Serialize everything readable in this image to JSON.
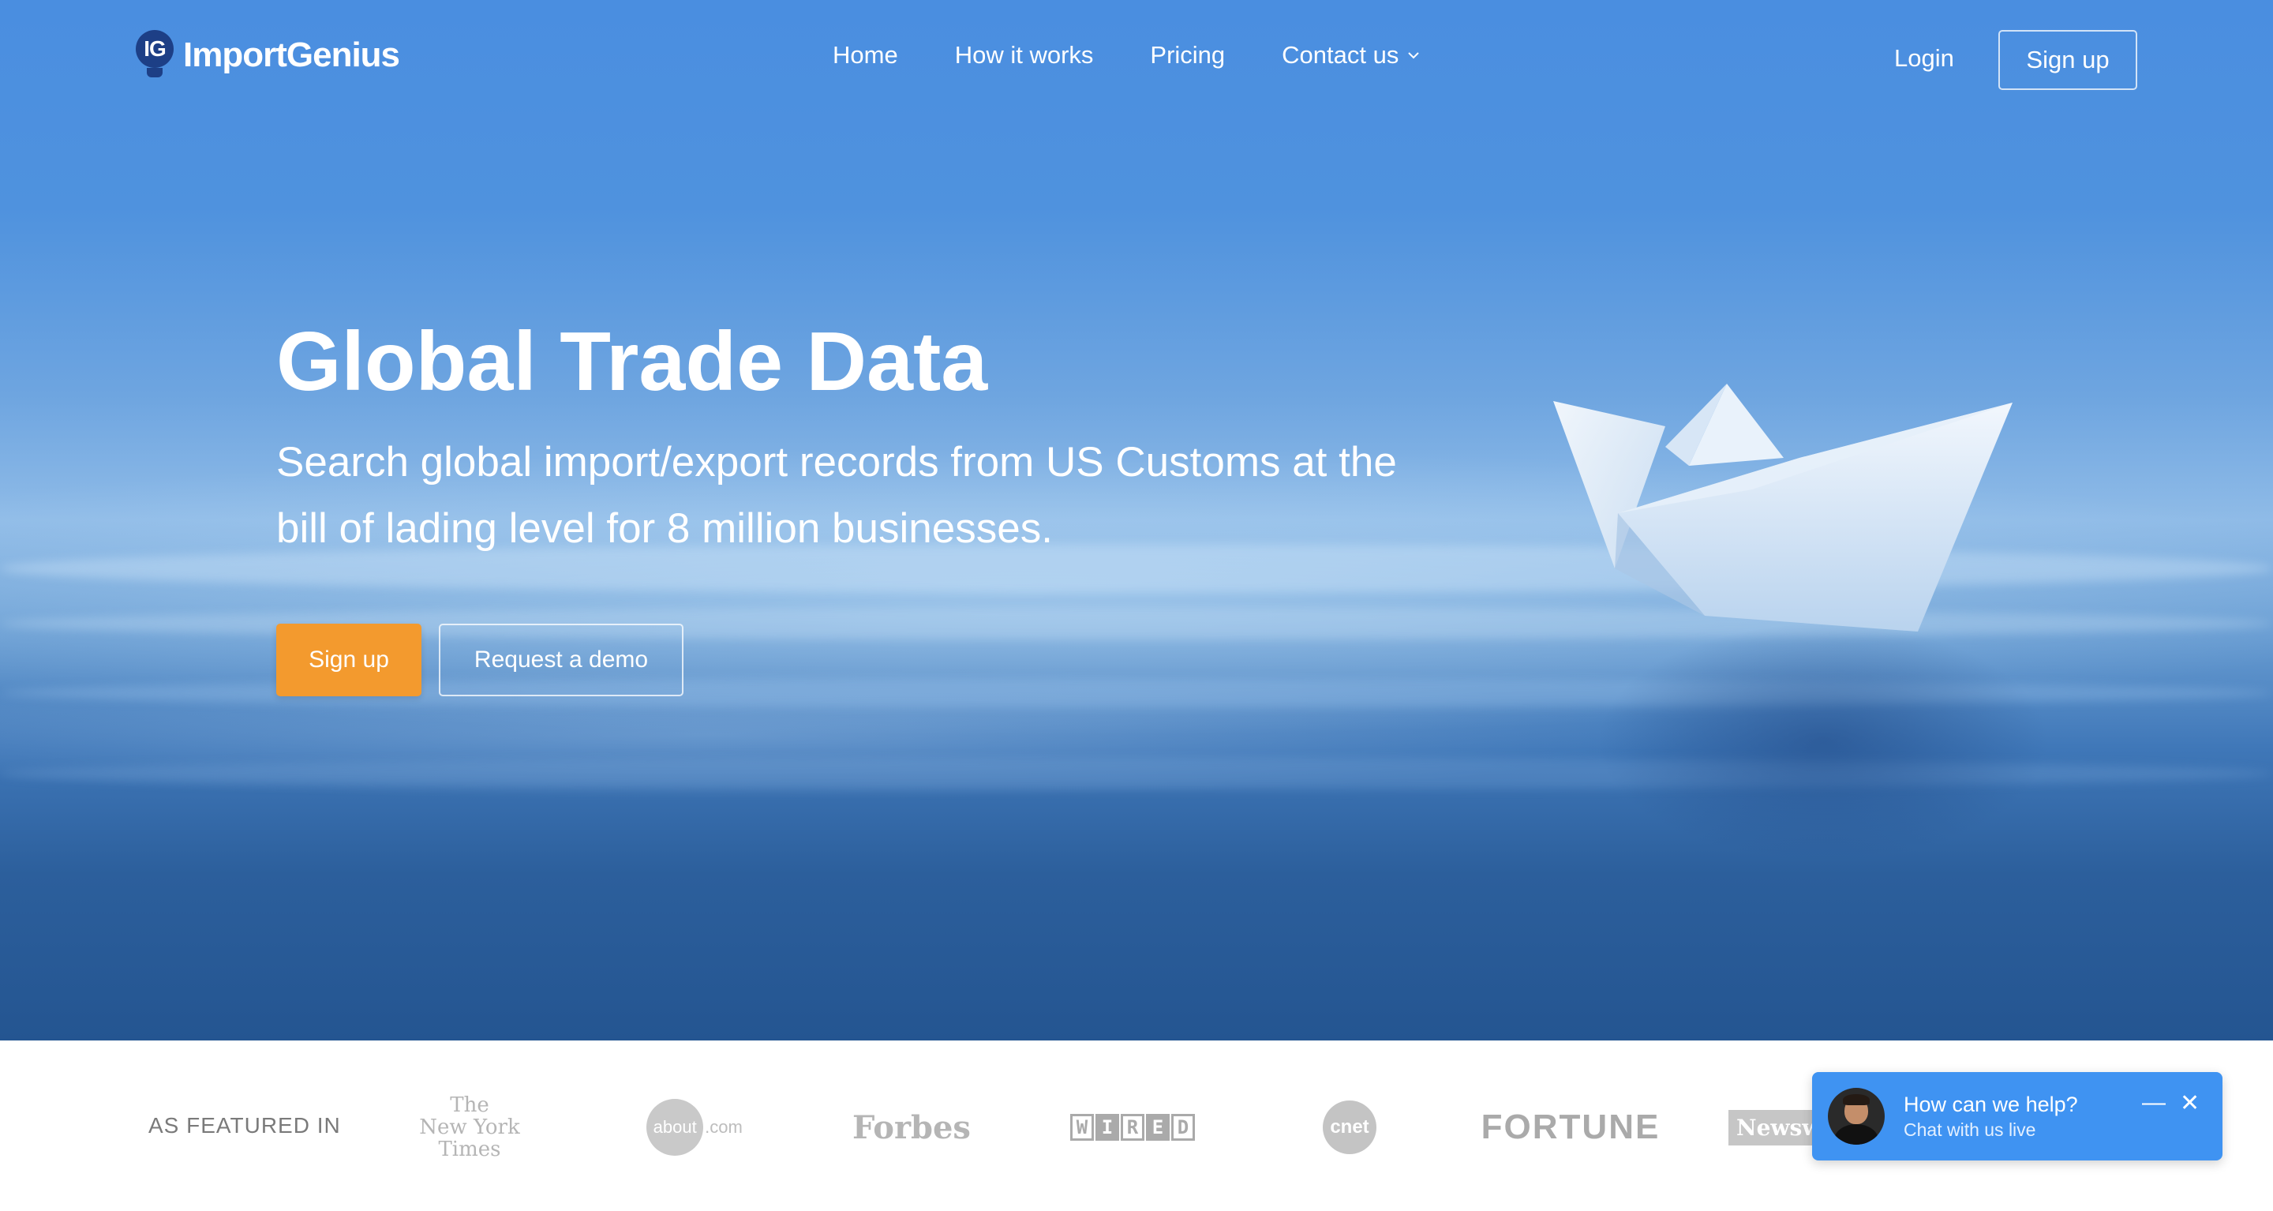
{
  "nav": {
    "logo_text": "ImportGenius",
    "logo_badge": "IG",
    "links": [
      "Home",
      "How it works",
      "Pricing",
      "Contact us"
    ],
    "login": "Login",
    "signup": "Sign up"
  },
  "hero": {
    "headline": "Global Trade Data",
    "subline": "Search global import/export records from US Customs at the bill of lading level for 8 million businesses.",
    "cta_primary": "Sign up",
    "cta_secondary": "Request a demo"
  },
  "featured": {
    "label": "AS FEATURED IN",
    "logos": {
      "nyt_1": "The",
      "nyt_2": "New York",
      "nyt_3": "Times",
      "about": "about",
      "about_suffix": ".com",
      "forbes": "Forbes",
      "wired": [
        "W",
        "I",
        "R",
        "E",
        "D"
      ],
      "cnet": "cnet",
      "fortune": "FORTUNE",
      "newsweek": "Newsweek"
    }
  },
  "chat": {
    "title": "How can we help?",
    "subtitle": "Chat with us live",
    "minimize": "—",
    "close": "✕"
  },
  "colors": {
    "accent_orange": "#f39a2e",
    "chat_blue": "#3f93f2",
    "logo_navy": "#1d3f86"
  }
}
